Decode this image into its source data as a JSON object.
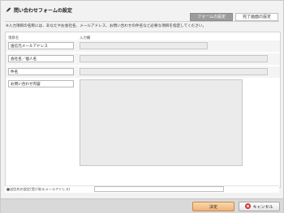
{
  "header": {
    "title": "問い合わせフォームの設定",
    "tabs": [
      {
        "label": "フォームの設定",
        "active": true
      },
      {
        "label": "完了画面の設定",
        "active": false
      }
    ],
    "description": "※入力項目の名称には、あなたやお会社名、メールアドレス、お問い合わせの件名など必要な項目を指定してください。"
  },
  "form": {
    "col_label": "項目名",
    "col_input": "入力欄",
    "fields": [
      {
        "label": "送信元メールアドレス"
      },
      {
        "label": "会社名／個人名"
      },
      {
        "label": "件名"
      },
      {
        "label": "お問い合わせ内容"
      }
    ],
    "email_label": "■送信先の設定(受け取るメールアドレス)",
    "email_value": ""
  },
  "buttons": {
    "ok": "決定",
    "cancel": "キャンセル"
  },
  "colors": {
    "ok_button": "#eeb277",
    "active_tab": "#9c9c9c",
    "cancel_icon": "#d33030"
  }
}
